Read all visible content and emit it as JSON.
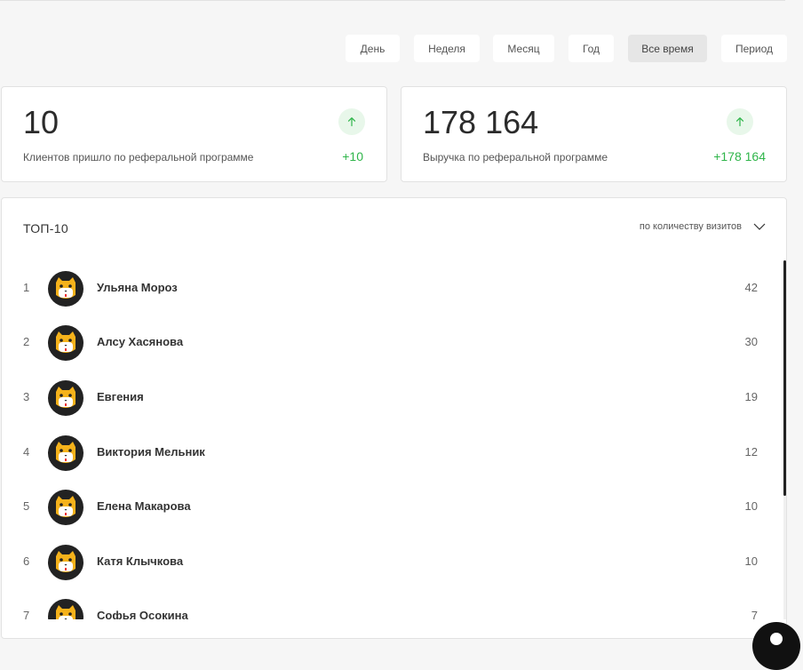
{
  "period_filter": {
    "buttons": [
      "День",
      "Неделя",
      "Месяц",
      "Год",
      "Все время",
      "Период"
    ],
    "active": "Все время"
  },
  "stats": [
    {
      "value": "10",
      "label": "Клиентов пришло по реферальной программе",
      "delta": "+10",
      "icon": "arrow-up-icon"
    },
    {
      "value": "178 164",
      "label": "Выручка по реферальной программе",
      "delta": "+178 164",
      "icon": "arrow-up-icon"
    }
  ],
  "top": {
    "title": "ТОП-10",
    "sort_label": "по количеству визитов",
    "sort_icon": "chevron-down-icon",
    "rows": [
      {
        "rank": "1",
        "name": "Ульяна Мороз",
        "count": "42"
      },
      {
        "rank": "2",
        "name": "Алсу Хасянова",
        "count": "30"
      },
      {
        "rank": "3",
        "name": "Евгения",
        "count": "19"
      },
      {
        "rank": "4",
        "name": "Виктория Мельник",
        "count": "12"
      },
      {
        "rank": "5",
        "name": "Елена Макарова",
        "count": "10"
      },
      {
        "rank": "6",
        "name": "Катя Клычкова",
        "count": "10"
      },
      {
        "rank": "7",
        "name": "Софья Осокина",
        "count": "7"
      }
    ]
  },
  "colors": {
    "positive": "#2fb54a",
    "avatar_bg": "#222222",
    "cat": "#f5b21b"
  }
}
